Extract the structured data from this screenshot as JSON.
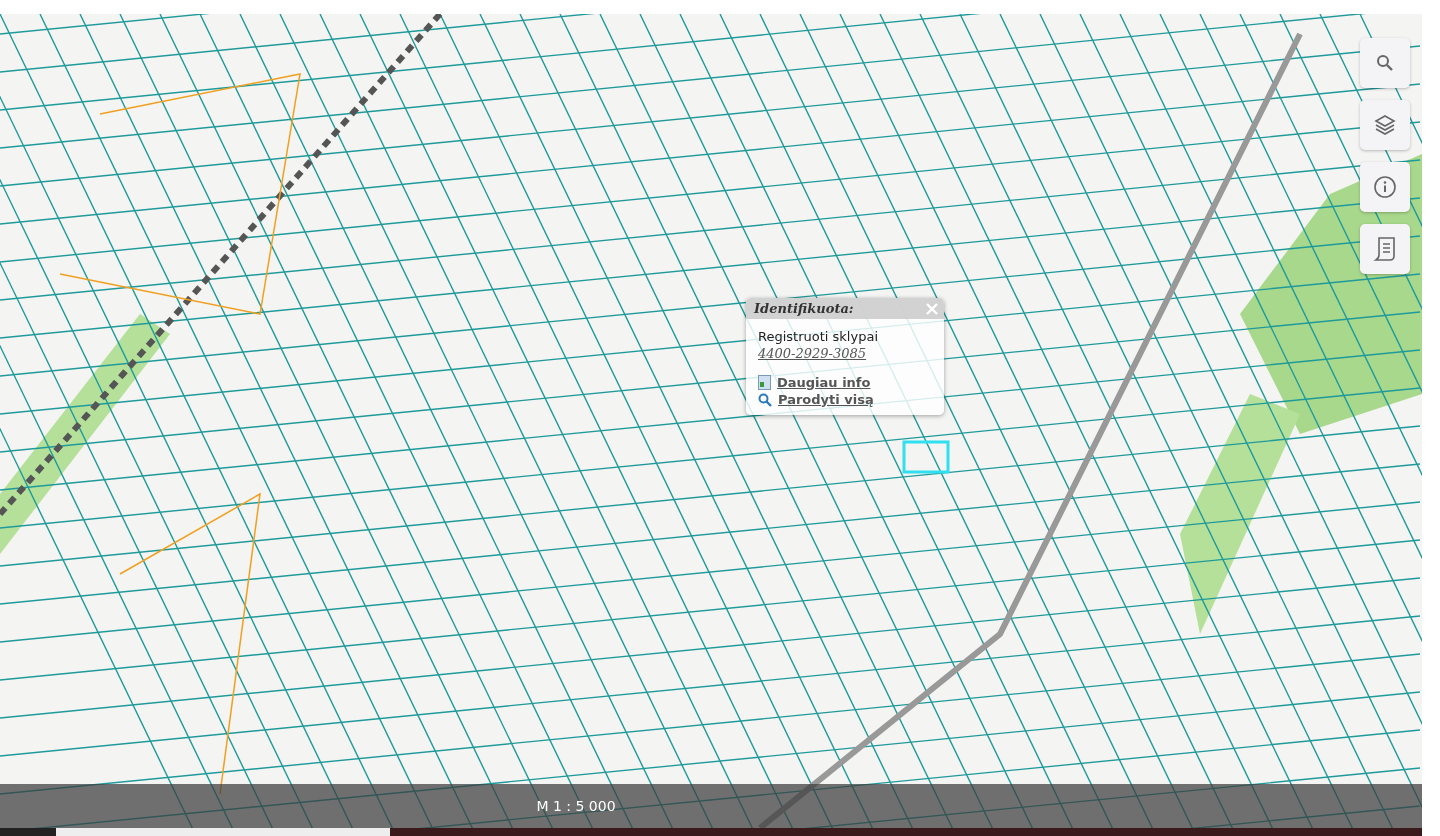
{
  "popup": {
    "title": "Identifikuota:",
    "heading": "Registruoti sklypai",
    "parcel_id": "4400-2929-3085",
    "links": [
      {
        "kind": "info",
        "label": "Daugiau info"
      },
      {
        "kind": "zoom",
        "label": "Parodyti visą"
      }
    ]
  },
  "tools": [
    {
      "kind": "search"
    },
    {
      "kind": "layers"
    },
    {
      "kind": "info"
    },
    {
      "kind": "legend"
    }
  ],
  "scale": "M 1 : 5 000"
}
